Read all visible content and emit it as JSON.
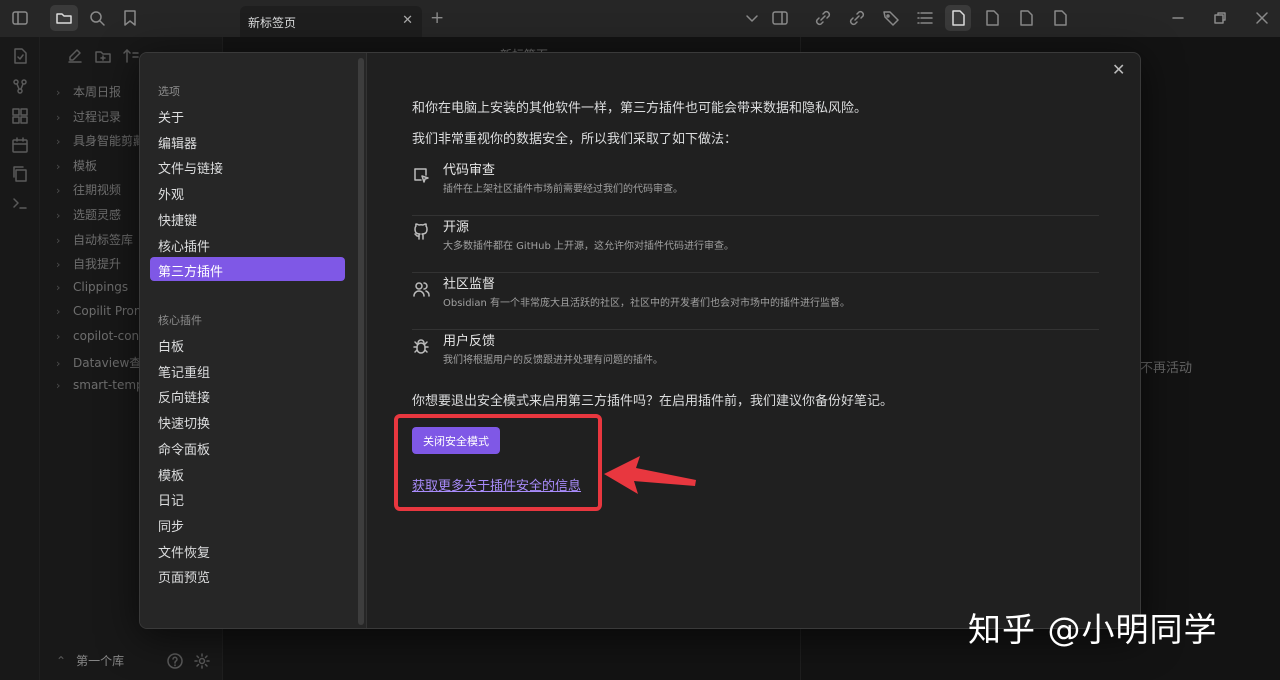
{
  "titlebar": {
    "tab_title": "新标签页",
    "tab_close": "✕",
    "tab_add": "+"
  },
  "editor": {
    "header_title": "新标签页"
  },
  "file_tree": {
    "items": [
      "本周日报",
      "过程记录",
      "具身智能剪藏",
      "模板",
      "往期视频",
      "选题灵感",
      "自动标签库",
      "自我提升",
      "Clippings",
      "Copilit Prompts",
      "copilot-conversations",
      "Dataview查询",
      "smart-templates"
    ],
    "vault_name": "第一个库"
  },
  "right_panel": {
    "text": "不再活动"
  },
  "modal": {
    "close_label": "✕",
    "sidebar": {
      "section_options": "选项",
      "options": [
        "关于",
        "编辑器",
        "文件与链接",
        "外观",
        "快捷键",
        "核心插件",
        "第三方插件"
      ],
      "active_index": 6,
      "section_core": "核心插件",
      "core_plugins": [
        "白板",
        "笔记重组",
        "反向链接",
        "快速切换",
        "命令面板",
        "模板",
        "日记",
        "同步",
        "文件恢复",
        "页面预览"
      ]
    },
    "content": {
      "intro": "和你在电脑上安装的其他软件一样，第三方插件也可能会带来数据和隐私风险。",
      "measures_intro": "我们非常重视你的数据安全，所以我们采取了如下做法：",
      "features": [
        {
          "icon": "review-cursor-icon",
          "title": "代码审查",
          "desc": "插件在上架社区插件市场前需要经过我们的代码审查。"
        },
        {
          "icon": "github-icon",
          "title": "开源",
          "desc": "大多数插件都在 GitHub 上开源，这允许你对插件代码进行审查。"
        },
        {
          "icon": "users-icon",
          "title": "社区监督",
          "desc": "Obsidian 有一个非常庞大且活跃的社区，社区中的开发者们也会对市场中的插件进行监督。"
        },
        {
          "icon": "bug-icon",
          "title": "用户反馈",
          "desc": "我们将根据用户的反馈跟进并处理有问题的插件。"
        }
      ],
      "question": "你想要退出安全模式来启用第三方插件吗？在启用插件前，我们建议你备份好笔记。",
      "button_label": "关闭安全模式",
      "link_label": "获取更多关于插件安全的信息"
    }
  },
  "watermark": "知乎 @小明同学",
  "colors": {
    "accent": "#7f58e6",
    "annotation": "#e8373f",
    "link": "#a88bfa"
  }
}
